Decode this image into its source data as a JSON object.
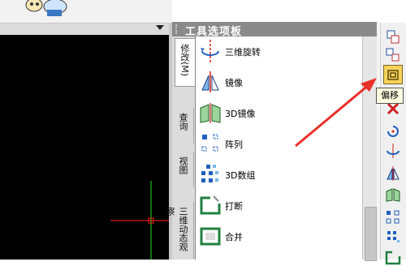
{
  "palette": {
    "title": "工具选项板",
    "tabs": [
      "修改(M)",
      "查询",
      "视图",
      "三维动态观察"
    ],
    "tools": [
      {
        "label": "三维旋转",
        "icon": "3d-rotate-icon"
      },
      {
        "label": "镜像",
        "icon": "mirror-icon"
      },
      {
        "label": "3D镜像",
        "icon": "3d-mirror-icon"
      },
      {
        "label": "阵列",
        "icon": "array-icon"
      },
      {
        "label": "3D数组",
        "icon": "3d-array-icon"
      },
      {
        "label": "打断",
        "icon": "break-icon"
      },
      {
        "label": "合并",
        "icon": "join-icon"
      }
    ]
  },
  "toolbar": {
    "tooltip": "偏移",
    "active_tool": "offset-icon"
  },
  "colors": {
    "canvas_bg": "#000000",
    "crosshair_x": "#ff2020",
    "crosshair_y": "#20e020",
    "arrow": "#e8302a",
    "active_tool_bg": "#f7d35a"
  }
}
